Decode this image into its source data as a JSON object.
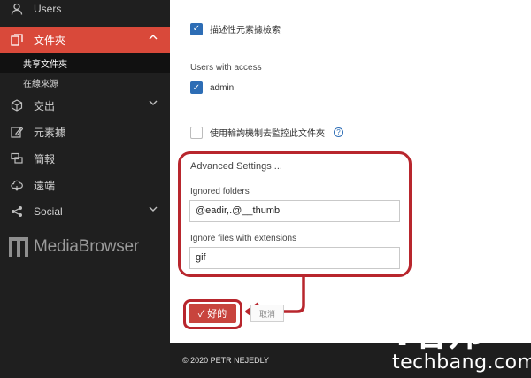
{
  "sidebar": {
    "users_label": "Users",
    "folders_label": "文件夾",
    "sub_items": [
      "共享文件夾",
      "在線來源"
    ],
    "export_label": "交出",
    "metadata_label": "元素據",
    "briefing_label": "簡報",
    "remote_label": "遠端",
    "social_label": "Social",
    "brand": "MediaBrowser"
  },
  "main": {
    "descriptive_search_label": "描述性元素據檢索",
    "users_with_access_label": "Users with access",
    "admin_label": "admin",
    "polling_label": "使用輪詢機制去監控此文件夾",
    "advanced_title": "Advanced Settings ...",
    "ignored_folders_label": "Ignored folders",
    "ignored_folders_value": "@eadir,.@__thumb",
    "ignore_ext_label": "Ignore files with extensions",
    "ignore_ext_value": "gif",
    "ok_label": "✓ 好的",
    "cancel_label": "取消"
  },
  "footer": {
    "copyright": "© 2020 PETR NEJEDLY"
  },
  "watermark": {
    "big": "T客邦",
    "small": "techbang.com"
  },
  "colors": {
    "sidebar_bg": "#1f1f1f",
    "active_item": "#d9493a",
    "checkbox_blue": "#2d6db5",
    "annotation_red": "#b8262d"
  }
}
